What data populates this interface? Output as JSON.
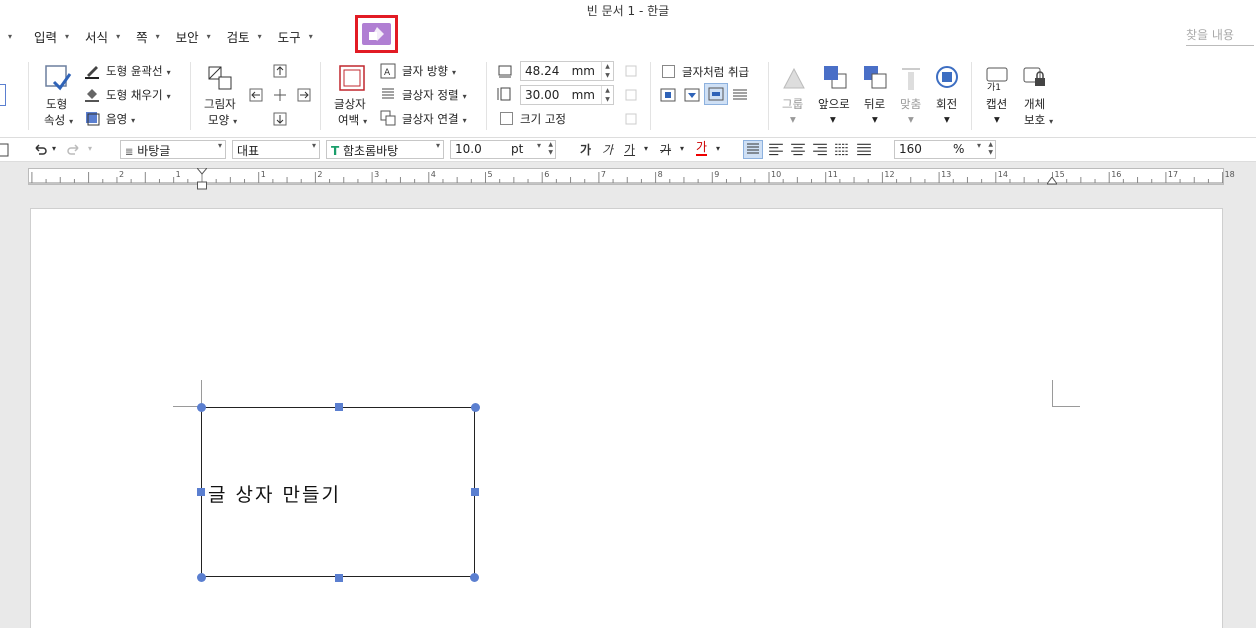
{
  "window": {
    "title": "빈 문서 1 - 한글"
  },
  "menu": {
    "items": [
      "입력",
      "서식",
      "쪽",
      "보안",
      "검토",
      "도구"
    ],
    "search_placeholder": "찾을 내용"
  },
  "ribbon": {
    "shape_props": {
      "line1": "도형",
      "line2": "속성"
    },
    "outline": "도형 윤곽선",
    "fill": "도형 채우기",
    "shadow": "음영",
    "picture_shape": {
      "line1": "그림자",
      "line2": "모양"
    },
    "textbox_margin": {
      "line1": "글상자",
      "line2": "여백"
    },
    "text_direction": "글자 방향",
    "textbox_align": "글상자 정렬",
    "textbox_link": "글상자 연결",
    "width": {
      "value": "48.24",
      "unit": "mm"
    },
    "height": {
      "value": "30.00",
      "unit": "mm"
    },
    "fix_size": "크기 고정",
    "treat_as_char": "글자처럼 취급",
    "group": "그룹",
    "bring_front": "앞으로",
    "send_back": "뒤로",
    "align": "맞춤",
    "rotate": "회전",
    "caption": "캡션",
    "caption_icon_text": "가1",
    "protect": {
      "line1": "개체",
      "line2": "보호"
    }
  },
  "format_bar": {
    "style": "바탕글",
    "lang": "대표",
    "font": "함초롬바탕",
    "size": {
      "value": "10.0",
      "unit": "pt"
    },
    "bold": "가",
    "italic": "가",
    "underline": "가",
    "strike": "가",
    "color": "가",
    "zoom": {
      "value": "160",
      "unit": "%"
    }
  },
  "ruler": {
    "numbers": [
      "2",
      "1",
      "1",
      "2",
      "3",
      "4",
      "5",
      "6",
      "7",
      "8",
      "9",
      "10",
      "11",
      "12",
      "13",
      "14",
      "15",
      "16",
      "17",
      "18"
    ]
  },
  "document": {
    "textbox_text": "글 상자 만들기"
  },
  "colors": {
    "accent_tab": "#b07fd3",
    "highlight_border": "#e21b24",
    "handle": "#5b7fd0"
  }
}
